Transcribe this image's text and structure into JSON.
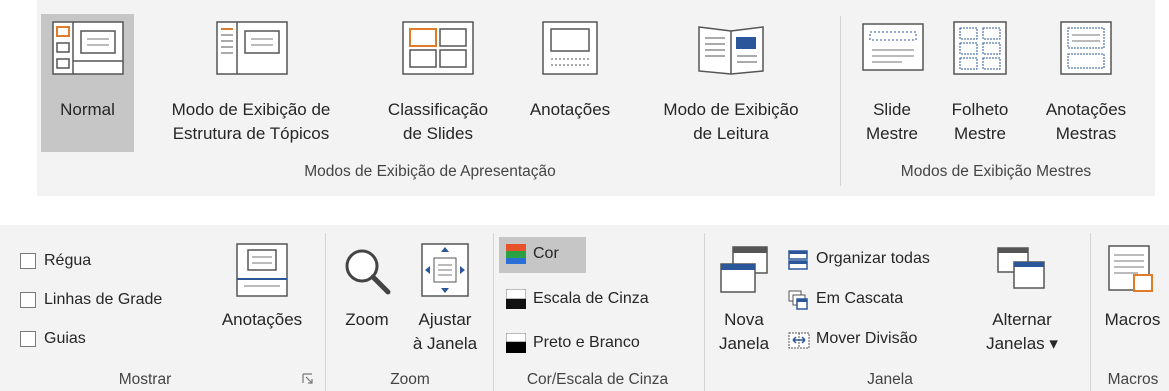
{
  "top_ribbon": {
    "presentation_views": {
      "group_label": "Modos de Exibição de Apresentação",
      "normal": "Normal",
      "outline": "Modo de Exibição de\nEstrutura de Tópicos",
      "slide_sorter": "Classificação\nde Slides",
      "notes_page": "Anotações",
      "reading_view": "Modo de Exibição\nde Leitura"
    },
    "master_views": {
      "group_label": "Modos de Exibição Mestres",
      "slide_master": "Slide\nMestre",
      "handout_master": "Folheto\nMestre",
      "notes_master": "Anotações\nMestras"
    }
  },
  "bottom_ribbon": {
    "show": {
      "group_label": "Mostrar",
      "ruler": "Régua",
      "gridlines": "Linhas de Grade",
      "guides": "Guias",
      "notes": "Anotações"
    },
    "zoom": {
      "group_label": "Zoom",
      "zoom": "Zoom",
      "fit_to_window": "Ajustar\nà Janela"
    },
    "color": {
      "group_label": "Cor/Escala de Cinza",
      "color": "Cor",
      "grayscale": "Escala de Cinza",
      "black_white": "Preto e Branco"
    },
    "window": {
      "group_label": "Janela",
      "new_window": "Nova\nJanela",
      "arrange_all": "Organizar todas",
      "cascade": "Em Cascata",
      "move_split": "Mover Divisão",
      "switch_windows": "Alternar\nJanelas ▾"
    },
    "macros": {
      "group_label": "Macros",
      "macros": "Macros"
    }
  },
  "colors": {
    "selected": "#c6c6c6",
    "ribbon_bg": "#f3f3f3",
    "accent_blue": "#2b579a",
    "orange": "#e07b2a"
  }
}
